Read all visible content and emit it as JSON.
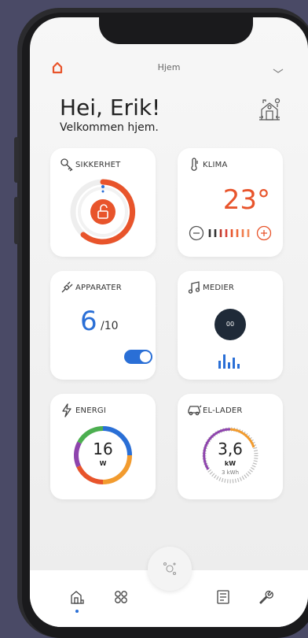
{
  "topbar": {
    "title": "Hjem"
  },
  "greeting": {
    "title": "Hei, Erik!",
    "subtitle": "Velkommen hjem."
  },
  "cards": {
    "security": {
      "label": "SIKKERHET"
    },
    "climate": {
      "label": "KLIMA",
      "temperature": "23°"
    },
    "appliances": {
      "label": "APPARATER",
      "count": "6",
      "total": "/10"
    },
    "media": {
      "label": "MEDIER",
      "button_text": "00"
    },
    "energy": {
      "label": "ENERGI",
      "value": "16",
      "unit": "W"
    },
    "charger": {
      "label": "EL-LADER",
      "value": "3,6",
      "unit": "kW",
      "sub": "3 kWh"
    }
  },
  "colors": {
    "accent_orange": "#e8542b",
    "accent_blue": "#2a6fd6",
    "dark": "#1f2a38"
  },
  "icons": {
    "topbar": [
      "home-icon",
      "chevron-down-icon"
    ],
    "house": "house-icon",
    "bottom_nav": [
      "home-nav-icon",
      "grid-icon",
      "assistant-icon",
      "list-icon",
      "wrench-icon"
    ]
  }
}
